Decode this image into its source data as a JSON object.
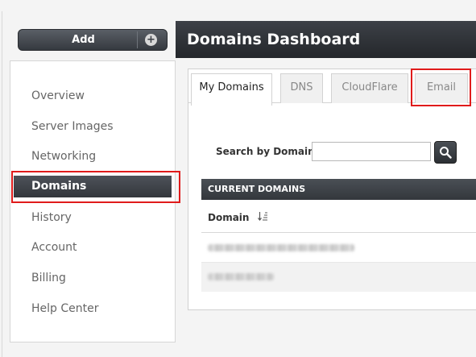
{
  "add_button": {
    "label": "Add",
    "icon": "plus-icon"
  },
  "header": {
    "title": "Domains Dashboard"
  },
  "sidebar": {
    "items": [
      {
        "label": "Overview",
        "active": false
      },
      {
        "label": "Server Images",
        "active": false
      },
      {
        "label": "Networking",
        "active": false
      },
      {
        "label": "Domains",
        "active": true
      },
      {
        "label": "History",
        "active": false
      },
      {
        "label": "Account",
        "active": false
      },
      {
        "label": "Billing",
        "active": false
      },
      {
        "label": "Help Center",
        "active": false
      }
    ]
  },
  "tabs": [
    {
      "label": "My Domains",
      "active": true
    },
    {
      "label": "DNS",
      "active": false
    },
    {
      "label": "CloudFlare",
      "active": false
    },
    {
      "label": "Email",
      "active": false
    }
  ],
  "search": {
    "label": "Search by Domain:",
    "value": "",
    "icon": "magnifier-icon"
  },
  "table": {
    "title": "CURRENT DOMAINS",
    "column_header": "Domain",
    "sort_icon": "sort-descending-icon"
  },
  "colors": {
    "dark_bar": "#33373c",
    "highlight": "#e01b1b",
    "panel": "#ffffff"
  }
}
